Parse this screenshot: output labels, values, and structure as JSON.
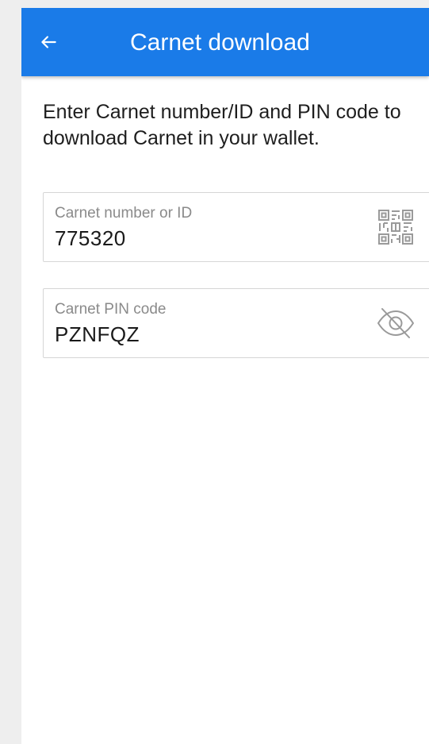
{
  "header": {
    "title": "Carnet download",
    "back_icon": "arrow-left-icon",
    "background_color": "#1a7be8"
  },
  "instructions": "Enter Carnet number/ID and PIN code to download Carnet in your wallet.",
  "fields": {
    "carnet_number": {
      "label": "Carnet number or ID",
      "value": "775320",
      "icon": "qr-code-icon"
    },
    "pin": {
      "label": "Carnet PIN code",
      "value": "PZNFQZ",
      "icon": "eye-off-icon"
    }
  }
}
